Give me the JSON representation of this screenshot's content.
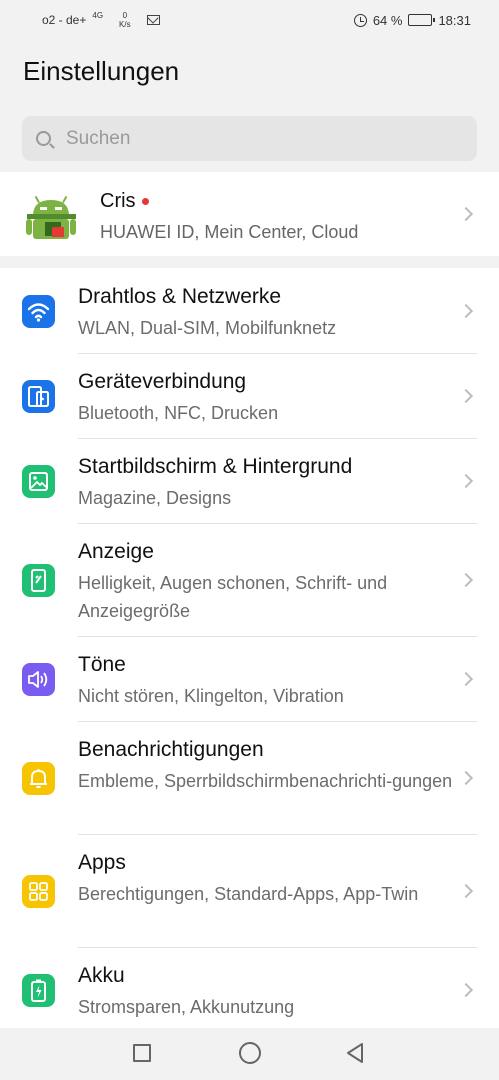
{
  "status_bar": {
    "carrier": "o2 - de+",
    "network": "4G",
    "speed_value": "0",
    "speed_unit": "K/s",
    "battery": "64 %",
    "battery_level": 0.64,
    "time": "18:31",
    "icons": [
      "mail-icon",
      "alarm-icon",
      "battery-icon"
    ]
  },
  "header": {
    "title": "Einstellungen"
  },
  "search": {
    "placeholder": "Suchen"
  },
  "profile": {
    "name": "Cris",
    "subtitle": "HUAWEI ID, Mein Center, Cloud"
  },
  "settings": [
    {
      "label": "Drahtlos & Netzwerke",
      "sub": "WLAN, Dual-SIM, Mobilfunknetz",
      "icon": "wifi-icon",
      "color": "#1a73e8"
    },
    {
      "label": "Geräteverbindung",
      "sub": "Bluetooth, NFC, Drucken",
      "icon": "device-connection-icon",
      "color": "#1a73e8"
    },
    {
      "label": "Startbildschirm & Hintergrund",
      "sub": "Magazine, Designs",
      "icon": "wallpaper-icon",
      "color": "#1fbf74"
    },
    {
      "label": "Anzeige",
      "sub": "Helligkeit, Augen schonen, Schrift- und Anzeigegröße",
      "icon": "display-icon",
      "color": "#1fbf74"
    },
    {
      "label": "Töne",
      "sub": "Nicht stören, Klingelton, Vibration",
      "icon": "sound-icon",
      "color": "#7a5cf0"
    },
    {
      "label": "Benachrichtigungen",
      "sub": "Embleme, Sperrbildschirmbenachrichti-gungen",
      "icon": "bell-icon",
      "color": "#f6c400"
    },
    {
      "label": "Apps",
      "sub": "Berechtigungen, Standard-Apps, App-Twin",
      "icon": "apps-grid-icon",
      "color": "#f6c400"
    },
    {
      "label": "Akku",
      "sub": "Stromsparen, Akkunutzung",
      "icon": "battery-charge-icon",
      "color": "#1fbf74"
    }
  ],
  "navbar": {
    "icons": [
      "recent-apps-icon",
      "home-icon",
      "back-icon"
    ]
  }
}
